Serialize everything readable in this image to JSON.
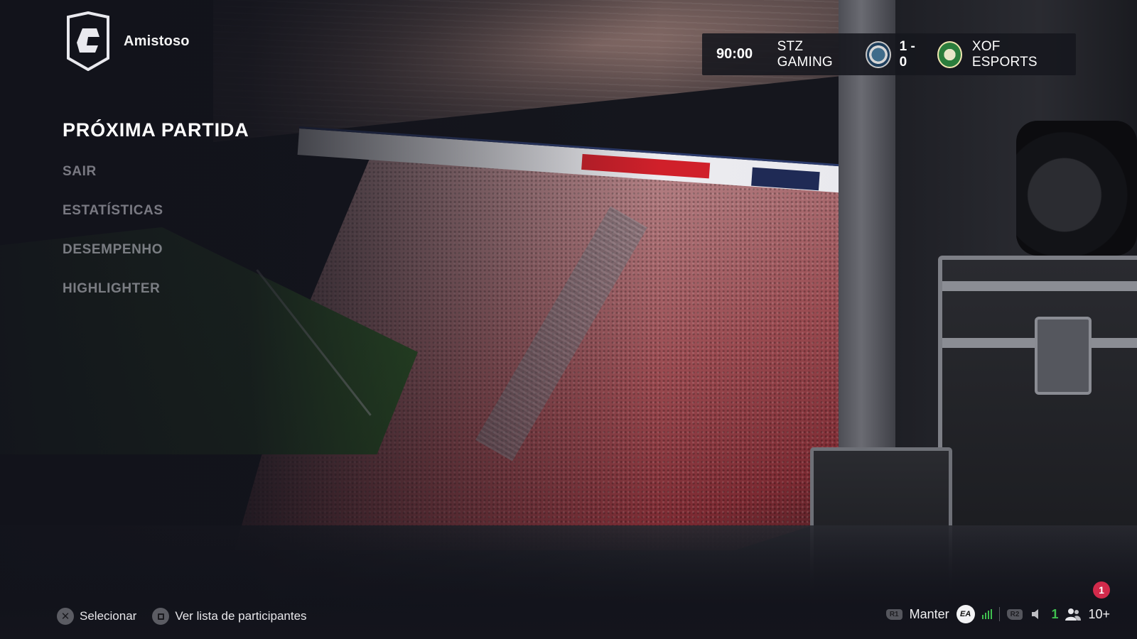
{
  "header": {
    "mode_title": "Amistoso",
    "logo_icon": "club-shield-icon"
  },
  "scoreboard": {
    "time": "90:00",
    "home_team": "STZ GAMING",
    "score": "1 - 0",
    "away_team": "XOF ESPORTS"
  },
  "menu": {
    "items": [
      {
        "label": "PRÓXIMA PARTIDA",
        "active": true
      },
      {
        "label": "SAIR"
      },
      {
        "label": "ESTATÍSTICAS"
      },
      {
        "label": "DESEMPENHO"
      },
      {
        "label": "HIGHLIGHTER"
      }
    ]
  },
  "hints": {
    "select_label": "Selecionar",
    "participants_label": "Ver lista de participantes"
  },
  "status": {
    "r1_label": "R1",
    "hold_label": "Manter",
    "ea_label": "EA",
    "r2_label": "R2",
    "voice_count": "1",
    "players_count": "10+",
    "notification_count": "1",
    "accent_green": "#3fbf4f",
    "badge_color": "#d22a4b"
  }
}
